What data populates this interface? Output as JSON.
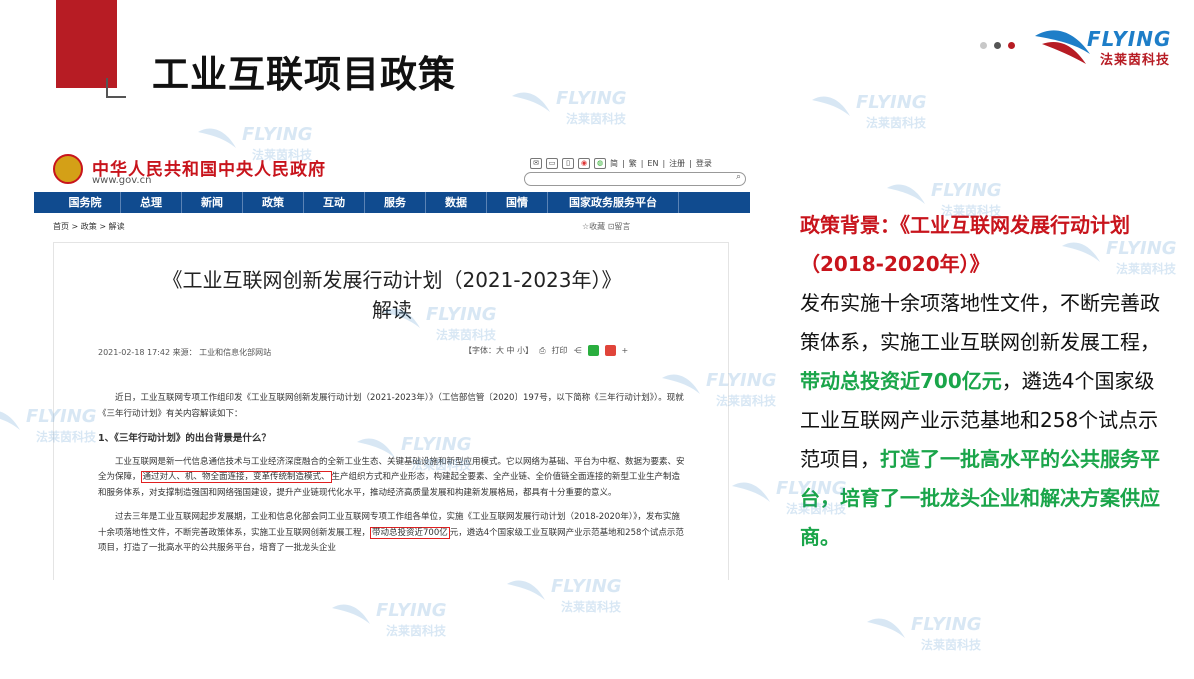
{
  "slide": {
    "title": "工业互联项目政策",
    "dot_colors": [
      "#c8c8c8",
      "#555555",
      "#b71c24"
    ]
  },
  "logo": {
    "en": "FLYING",
    "cn": "法莱茵科技"
  },
  "watermark": {
    "en": "FLYING",
    "cn": "法莱茵科技"
  },
  "gov": {
    "site_name": "中华人民共和国中央人民政府",
    "url": "www.gov.cn",
    "tools": [
      "简",
      "繁",
      "EN",
      "注册",
      "登录"
    ],
    "nav": [
      "国务院",
      "总理",
      "新闻",
      "政策",
      "互动",
      "服务",
      "数据",
      "国情",
      "国家政务服务平台"
    ],
    "breadcrumb": "首页 > 政策 > 解读",
    "actions": "☆收藏   ⊡留言"
  },
  "article": {
    "title_line1": "《工业互联网创新发展行动计划（2021-2023年）》",
    "title_line2": "解读",
    "meta": "2021-02-18 17:42    来源：   工业和信息化部网站",
    "font_size": "【字体：大  中  小】",
    "print": "打印",
    "p1": "近日，工业互联网专项工作组印发《工业互联网创新发展行动计划（2021-2023年）》（工信部信管〔2020〕197号，以下简称《三年行动计划》）。现就《三年行动计划》有关内容解读如下：",
    "h1": "1、《三年行动计划》的出台背景是什么？",
    "p2a": "工业互联网是新一代信息通信技术与工业经济深度融合的全新工业生态、关键基础设施和新型应用模式。它以网络为基础、平台为中枢、数据为要素、安全为保障，",
    "p2hl": "通过对人、机、物全面连接，变革传统制造模式、",
    "p2b": "生产组织方式和产业形态，构建起全要素、全产业链、全价值链全面连接的新型工业生产制造和服务体系，对支撑制造强国和网络强国建设，提升产业链现代化水平，推动经济高质量发展和构建新发展格局，都具有十分重要的意义。",
    "p3a": "过去三年是工业互联网起步发展期，工业和信息化部会同工业互联网专项工作组各单位，实施《工业互联网发展行动计划（2018-2020年）》，发布实施十余项落地性文件，不断完善政策体系，实施工业互联网创新发展工程，",
    "p3hl": "带动总投资近700亿",
    "p3b": "元，遴选4个国家级工业互联网产业示范基地和258个试点示范项目，打造了一批高水平的公共服务平台，培育了一批龙头企业"
  },
  "right": {
    "heading": "政策背景：《工业互联网发展行动计划（2018-2020年）》",
    "t1": "发布实施十余项落地性文件，不断完善政策体系，实施工业互联网创新发展工程，",
    "g1": "带动总投资近700亿元",
    "t2": "，遴选4个国家级工业互联网产业示范基地和258个试点示范项目，",
    "g2": "打造了一批高水平的公共服务平台，培育了一批龙头企业和解决方案供应商。"
  }
}
